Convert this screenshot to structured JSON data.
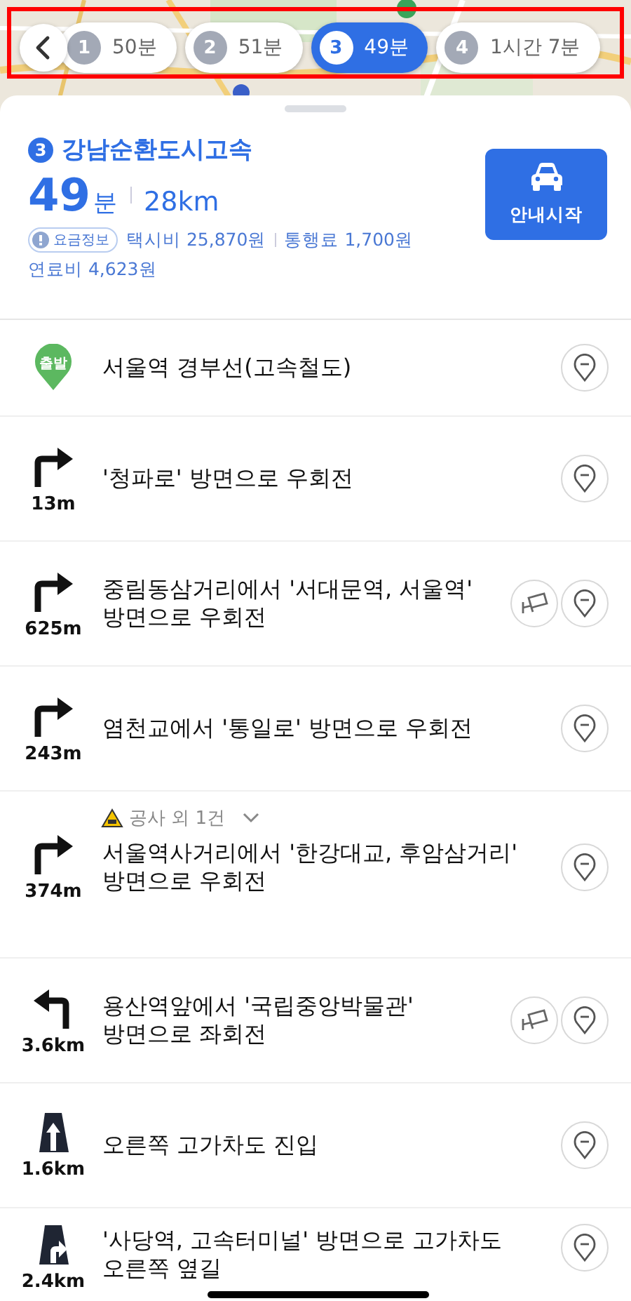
{
  "route_tabs": [
    {
      "number": "1",
      "duration": "50분",
      "selected": false
    },
    {
      "number": "2",
      "duration": "51분",
      "selected": false
    },
    {
      "number": "3",
      "duration": "49분",
      "selected": true
    },
    {
      "number": "4",
      "duration": "1시간 7분",
      "selected": false
    }
  ],
  "summary": {
    "route_number": "3",
    "route_name": "강남순환도시고속",
    "duration_value": "49",
    "duration_unit": "분",
    "distance": "28km",
    "fare_badge": "요금정보",
    "taxi_fare": "택시비 25,870원",
    "toll": "통행료 1,700원",
    "fuel": "연료비 4,623원"
  },
  "start_button": "안내시작",
  "steps": [
    {
      "kind": "start",
      "marker": "출발",
      "instruction": "서울역 경부선(고속철도)",
      "cctv": false
    },
    {
      "kind": "right",
      "distance": "13m",
      "instruction": "'청파로' 방면으로 우회전",
      "cctv": false
    },
    {
      "kind": "right",
      "distance": "625m",
      "instruction": "중림동삼거리에서 '서대문역, 서울역' 방면으로 우회전",
      "cctv": true
    },
    {
      "kind": "right",
      "distance": "243m",
      "instruction": "염천교에서 '통일로' 방면으로 우회전",
      "cctv": false
    },
    {
      "kind": "right",
      "distance": "374m",
      "instruction": "서울역사거리에서 '한강대교, 후암삼거리' 방면으로 우회전",
      "cctv": false,
      "notice": "공사 외 1건"
    },
    {
      "kind": "left",
      "distance": "3.6km",
      "instruction": "용산역앞에서 '국립중앙박물관' 방면으로 좌회전",
      "cctv": true
    },
    {
      "kind": "overpass",
      "distance": "1.6km",
      "instruction": "오른쪽 고가차도 진입",
      "cctv": false
    },
    {
      "kind": "overpass-right",
      "distance": "2.4km",
      "instruction": "'사당역, 고속터미널' 방면으로 고가차도 오른쪽 옆길",
      "cctv": false
    }
  ]
}
